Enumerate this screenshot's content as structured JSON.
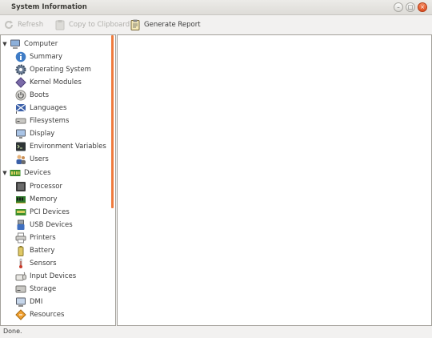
{
  "window": {
    "title": "System Information"
  },
  "toolbar": {
    "refresh_label": "Refresh",
    "copy_label": "Copy to Clipboard",
    "report_label": "Generate Report"
  },
  "sidebar": {
    "groups": [
      {
        "label": "Computer",
        "icon": "computer-icon",
        "expanded": true,
        "items": [
          {
            "label": "Summary",
            "icon": "info-icon"
          },
          {
            "label": "Operating System",
            "icon": "gear-icon"
          },
          {
            "label": "Kernel Modules",
            "icon": "module-icon"
          },
          {
            "label": "Boots",
            "icon": "power-icon"
          },
          {
            "label": "Languages",
            "icon": "flag-icon"
          },
          {
            "label": "Filesystems",
            "icon": "drive-icon"
          },
          {
            "label": "Display",
            "icon": "monitor-icon"
          },
          {
            "label": "Environment Variables",
            "icon": "terminal-icon"
          },
          {
            "label": "Users",
            "icon": "users-icon"
          }
        ]
      },
      {
        "label": "Devices",
        "icon": "pcb-icon",
        "expanded": true,
        "items": [
          {
            "label": "Processor",
            "icon": "cpu-icon"
          },
          {
            "label": "Memory",
            "icon": "memory-icon"
          },
          {
            "label": "PCI Devices",
            "icon": "pci-icon"
          },
          {
            "label": "USB Devices",
            "icon": "usb-icon"
          },
          {
            "label": "Printers",
            "icon": "printer-icon"
          },
          {
            "label": "Battery",
            "icon": "battery-icon"
          },
          {
            "label": "Sensors",
            "icon": "thermometer-icon"
          },
          {
            "label": "Input Devices",
            "icon": "keyboard-icon"
          },
          {
            "label": "Storage",
            "icon": "storage-icon"
          },
          {
            "label": "DMI",
            "icon": "dmi-icon"
          },
          {
            "label": "Resources",
            "icon": "resources-icon"
          }
        ]
      }
    ]
  },
  "statusbar": {
    "text": "Done."
  },
  "colors": {
    "accent": "#ef7b3e",
    "close_button": "#df4d1f"
  }
}
